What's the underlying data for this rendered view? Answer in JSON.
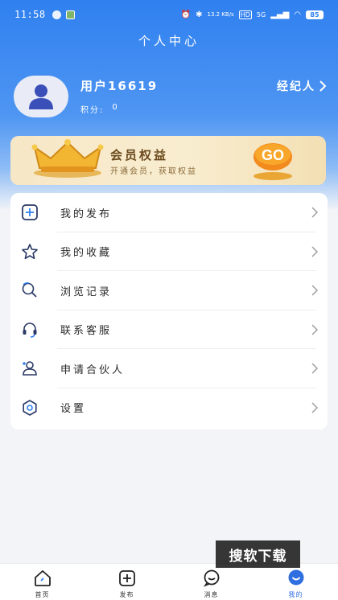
{
  "status_bar": {
    "time": "11:58",
    "net_speed": "13.2 KB/s",
    "hd": "HD",
    "signal": "5G",
    "battery": "85"
  },
  "header": {
    "title": "个人中心"
  },
  "user": {
    "name": "用户16619",
    "points_label": "积分:",
    "points_value": "0",
    "agent_label": "经纪人"
  },
  "vip": {
    "title": "会员权益",
    "subtitle": "开通会员，获取权益",
    "go_label": "GO"
  },
  "menu": {
    "items": [
      {
        "label": "我的发布",
        "icon": "add-square-icon"
      },
      {
        "label": "我的收藏",
        "icon": "star-icon"
      },
      {
        "label": "浏览记录",
        "icon": "history-icon"
      },
      {
        "label": "联系客服",
        "icon": "headset-icon"
      },
      {
        "label": "申请合伙人",
        "icon": "partner-icon"
      },
      {
        "label": "设置",
        "icon": "gear-icon"
      }
    ]
  },
  "tabbar": {
    "tabs": [
      {
        "label": "首页",
        "icon": "home-icon"
      },
      {
        "label": "发布",
        "icon": "publish-icon"
      },
      {
        "label": "消息",
        "icon": "message-icon"
      },
      {
        "label": "我的",
        "icon": "profile-icon"
      }
    ],
    "active": "我的"
  },
  "watermark": "搜软下载",
  "colors": {
    "primary": "#2f80f0",
    "vip_bg": "#f6e7c6",
    "vip_text": "#6a4a1d",
    "active_tab": "#2f6fe0"
  }
}
